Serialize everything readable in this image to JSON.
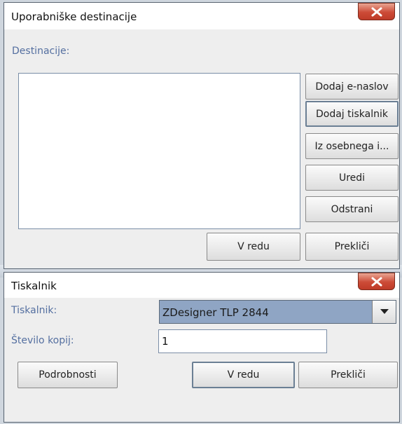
{
  "dialog1": {
    "title": "Uporabniške destinacije",
    "destinations_label": "Destinacije:",
    "buttons": {
      "add_email": "Dodaj e-naslov",
      "add_printer": "Dodaj tiskalnik",
      "from_personal": "Iz osebnega i...",
      "edit": "Uredi",
      "remove": "Odstrani",
      "ok": "V redu",
      "cancel": "Prekliči"
    }
  },
  "dialog2": {
    "title": "Tiskalnik",
    "printer_label": "Tiskalnik:",
    "printer_value": "ZDesigner TLP 2844",
    "copies_label": "Število kopij:",
    "copies_value": "1",
    "buttons": {
      "details": "Podrobnosti",
      "ok": "V redu",
      "cancel": "Prekliči"
    }
  },
  "icons": {
    "close": "close-icon",
    "dropdown": "chevron-down-icon"
  },
  "colors": {
    "label_text": "#546fa0",
    "close_button": "#cc4b37",
    "combo_selected": "#8fa5c4"
  }
}
